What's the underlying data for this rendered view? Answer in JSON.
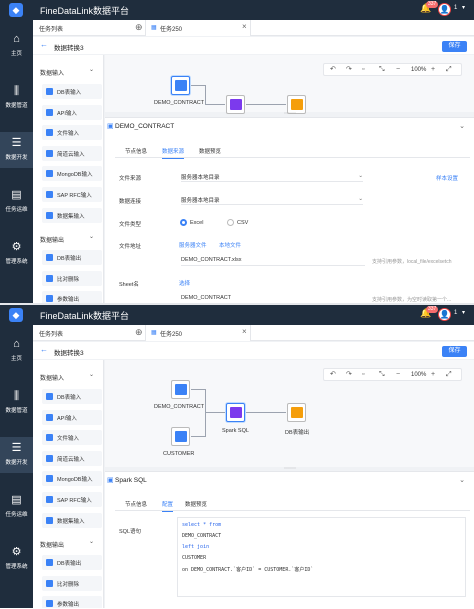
{
  "app": {
    "title": "FineDataLink数据平台",
    "notification_count": "337",
    "user_count": "1"
  },
  "nav": [
    {
      "label": "主页",
      "icon": "home-icon",
      "glyph": "⌂"
    },
    {
      "label": "数据管道",
      "icon": "pipeline-icon",
      "glyph": "⫼"
    },
    {
      "label": "数据开发",
      "icon": "develop-icon",
      "glyph": "☰"
    },
    {
      "label": "任务运维",
      "icon": "ops-icon",
      "glyph": "▤"
    },
    {
      "label": "管理系统",
      "icon": "gear-icon",
      "glyph": "⚙"
    }
  ],
  "tabs": {
    "list": "任务列表",
    "task": "任务250"
  },
  "header": {
    "title": "数据转换3",
    "save": "保存"
  },
  "left": {
    "input_group": "数据输入",
    "input_items": [
      "DB表输入",
      "API输入",
      "文件输入",
      "简道云输入",
      "MongoDB输入",
      "SAP RFC输入",
      "数据集输入"
    ],
    "output_group": "数据输出",
    "output_items": [
      "DB表输出",
      "比对删除",
      "参数输出"
    ]
  },
  "toolbar": {
    "zoom": "100%"
  },
  "flow": {
    "node_contract": "DEMO_CONTRACT",
    "node_customer": "CUSTOMER",
    "node_spark": "Spark SQL",
    "node_output": "DB表输出"
  },
  "panelA": {
    "title": "DEMO_CONTRACT",
    "tabs": [
      "节点信息",
      "数据来源",
      "数据预览"
    ],
    "file_source_label": "文件来源",
    "file_source_value": "服务器本地目录",
    "sample_link": "样本设置",
    "data_conn_label": "数据连接",
    "data_conn_value": "服务器本地目录",
    "file_type_label": "文件类型",
    "file_type_excel": "Excel",
    "file_type_csv": "CSV",
    "file_addr_label": "文件地址",
    "server_file_link": "服务器文件",
    "local_file_link": "本地文件",
    "file_addr_value": "DEMO_CONTRACT.xlsx",
    "file_addr_hint": "支持引用参数，local_file/excelsetch",
    "sheet_label": "Sheet名",
    "sheet_link": "选择",
    "sheet_value": "DEMO_CONTRACT",
    "sheet_hint": "支持引用参数，为空时读取第一个..."
  },
  "panelB": {
    "title": "Spark SQL",
    "tabs": [
      "节点信息",
      "配置",
      "数据预览"
    ],
    "sql_label": "SQL语句",
    "sql_lines": [
      "select * from",
      "DEMO_CONTRACT",
      "left join",
      "CUSTOMER",
      "on DEMO_CONTRACT.`客户ID` = CUSTOMER.`客户ID`"
    ]
  },
  "colors": {
    "accent": "#3b82f6",
    "nav_bg": "#1f2d3d",
    "folder": "#3b82f6",
    "spark": "#7c3aed",
    "output": "#f59e0b"
  }
}
